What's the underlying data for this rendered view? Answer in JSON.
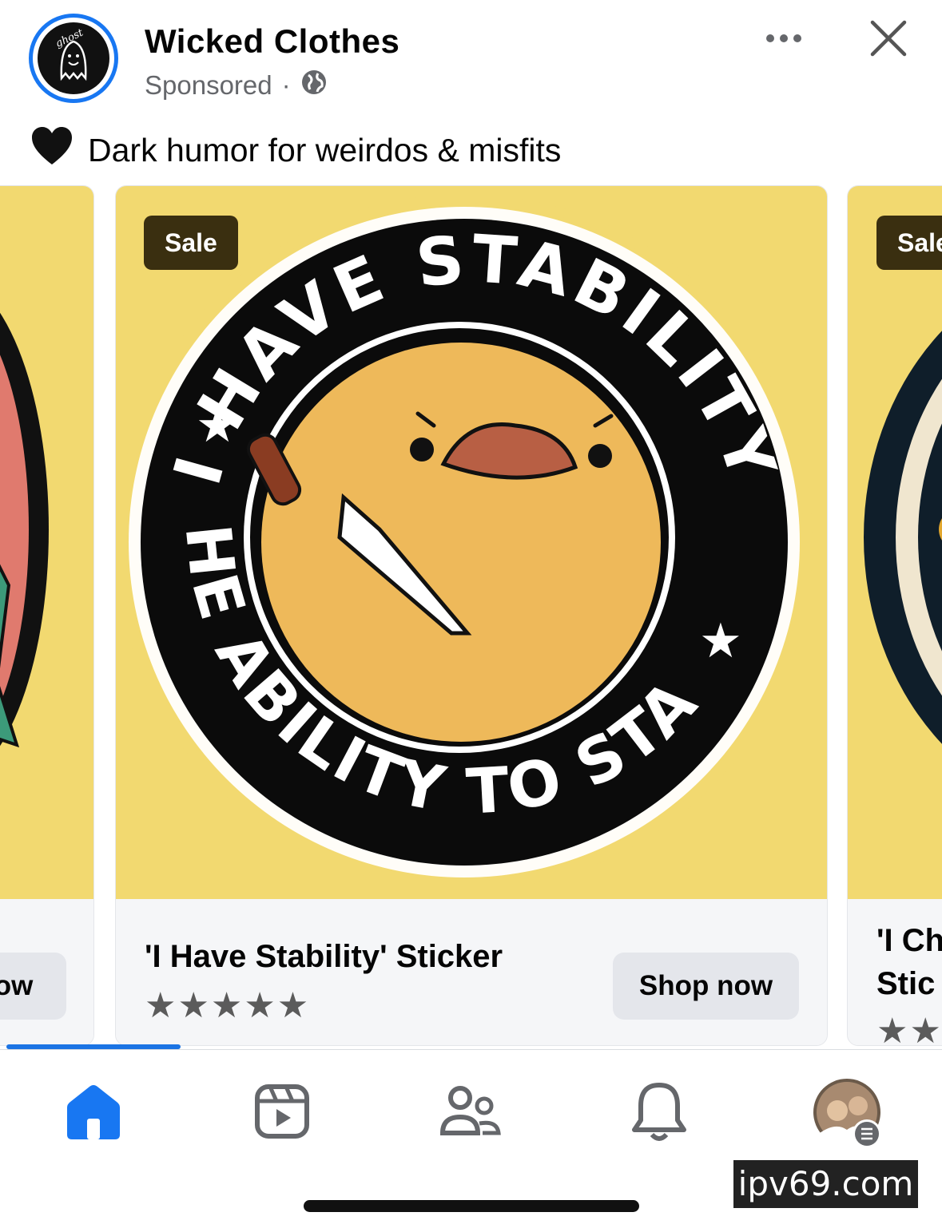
{
  "post": {
    "page_name": "Wicked Clothes",
    "sponsored_label": "Sponsored",
    "separator": "·",
    "audience_icon": "globe-icon",
    "more_icon": "more-horizontal-icon",
    "close_icon": "close-icon",
    "caption_emoji": "🖤",
    "caption": "Dark humor for weirdos & misfits",
    "avatar_logo_text": "ghost"
  },
  "carousel": {
    "cards": [
      {
        "position": "previous",
        "button_label": "ow"
      },
      {
        "position": "current",
        "badge": "Sale",
        "sticker_text_top": "I HAVE STABILITY",
        "sticker_text_bottom": "THE ABILITY TO STAB",
        "title": "'I Have Stability' Sticker",
        "rating_stars": "★★★★★",
        "rating_value": 5,
        "button_label": "Shop now"
      },
      {
        "position": "next",
        "badge": "Sale",
        "title_line1": "'I Ch",
        "title_line2": "Stic",
        "rating_stars": "★★"
      }
    ]
  },
  "tabbar": {
    "tabs": [
      {
        "name": "home",
        "icon": "home-icon",
        "active": true
      },
      {
        "name": "video",
        "icon": "video-icon",
        "active": false
      },
      {
        "name": "friends",
        "icon": "friends-icon",
        "active": false
      },
      {
        "name": "notifications",
        "icon": "bell-icon",
        "active": false
      },
      {
        "name": "profile-menu",
        "icon": "profile-avatar",
        "active": false
      }
    ]
  },
  "watermark": "ipv69.com",
  "colors": {
    "accent": "#1877f2",
    "card_image_bg": "#f2d970",
    "badge_bg": "#3a2f10",
    "duck": "#eeb95a",
    "beak": "#b85f44"
  }
}
